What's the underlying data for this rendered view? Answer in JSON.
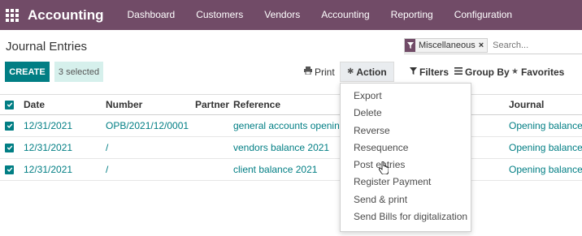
{
  "navbar": {
    "app_name": "Accounting",
    "menu": [
      "Dashboard",
      "Customers",
      "Vendors",
      "Accounting",
      "Reporting",
      "Configuration"
    ],
    "background": "#714B67"
  },
  "control": {
    "title": "Journal Entries",
    "facet_label": "Miscellaneous",
    "facet_close": "×",
    "search_placeholder": "Search...",
    "create_label": "CREATE",
    "selected_label": "3 selected",
    "print_label": "Print",
    "action_label": "Action",
    "filters_label": "Filters",
    "groupby_label": "Group By",
    "favorites_label": "Favorites",
    "accent": "#017e84"
  },
  "table": {
    "headers": {
      "date": "Date",
      "number": "Number",
      "partner": "Partner",
      "reference": "Reference",
      "journal": "Journal"
    },
    "rows": [
      {
        "date": "12/31/2021",
        "number": "OPB/2021/12/0001",
        "partner": "",
        "reference": "general accounts opening balance",
        "journal": "Opening balances"
      },
      {
        "date": "12/31/2021",
        "number": "/",
        "partner": "",
        "reference": "vendors balance 2021",
        "journal": "Opening balances"
      },
      {
        "date": "12/31/2021",
        "number": "/",
        "partner": "",
        "reference": "client balance 2021",
        "journal": "Opening balances"
      }
    ]
  },
  "action_menu": {
    "items": [
      "Export",
      "Delete",
      "Reverse",
      "Resequence",
      "Post entries",
      "Register Payment",
      "Send & print",
      "Send Bills for digitalization"
    ]
  },
  "icons": {
    "apps": "apps-grid-icon",
    "filter": "filter-icon",
    "print": "printer-icon",
    "action": "gear-icon",
    "groupby": "list-icon",
    "favorites": "star-icon"
  }
}
